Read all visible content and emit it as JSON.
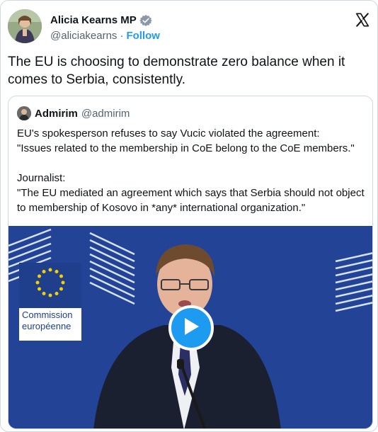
{
  "author": {
    "display_name": "Alicia Kearns MP",
    "handle": "@aliciakearns",
    "separator": "·",
    "follow_label": "Follow"
  },
  "tweet": {
    "text": "The EU is choosing to demonstrate zero balance when it comes to Serbia, consistently."
  },
  "quote": {
    "display_name": "Admirim",
    "handle": "@admirim",
    "body": "EU's spokesperson refuses to say Vucic violated the agreement:\n\"Issues related to the membership in CoE belong to the CoE members.\"\n\nJournalist:\n\"The EU mediated an agreement which says that Serbia should not object to membership of Kosovo in *any* international organization.\""
  },
  "video": {
    "sign_line1": "Commission",
    "sign_line2": "européenne"
  },
  "icons": {
    "verified": "verified-badge-icon",
    "logo": "x-logo-icon",
    "play": "play-icon"
  },
  "colors": {
    "accent": "#1d9bf0",
    "secondary_text": "#536471",
    "border": "#cfd9de",
    "video_bg": "#1e3f8f"
  }
}
